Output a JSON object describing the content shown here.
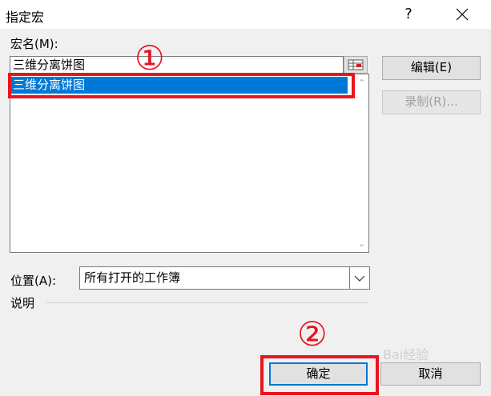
{
  "window": {
    "title": "指定宏",
    "help_symbol": "?"
  },
  "macro_name": {
    "label": "宏名(M):",
    "value": "三维分离饼图",
    "list_items": [
      "三维分离饼图"
    ],
    "selected_index": 0
  },
  "buttons": {
    "edit": "编辑(E)",
    "record": "录制(R)...",
    "ok": "确定",
    "cancel": "取消"
  },
  "location": {
    "label": "位置(A):",
    "selected": "所有打开的工作簿"
  },
  "description": {
    "label": "说明"
  },
  "annotations": {
    "marker_1": "①",
    "marker_2": "②",
    "color": "#e8141e"
  },
  "watermark": "Bai经验"
}
